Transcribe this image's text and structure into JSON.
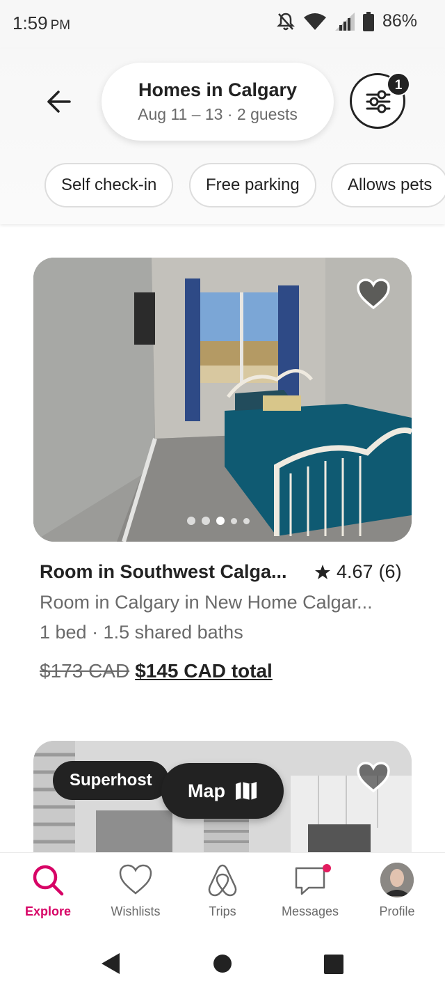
{
  "status_bar": {
    "time": "1:59",
    "ampm": "PM",
    "battery": "86%",
    "icons": [
      "notifications-off-icon",
      "wifi-icon",
      "signal-icon",
      "battery-icon"
    ]
  },
  "header": {
    "title": "Homes in Calgary",
    "subtitle": "Aug 11 – 13 · 2 guests",
    "filter_count": "1",
    "chips": [
      "Self check-in",
      "Free parking",
      "Allows pets"
    ]
  },
  "listings": [
    {
      "title": "Room in Southwest Calga...",
      "rating": "4.67",
      "reviews": "(6)",
      "subtitle": "Room in Calgary in New Home Calgar...",
      "beds": "1 bed · 1.5 shared baths",
      "old_price": "$173 CAD",
      "new_price": "$145 CAD total",
      "photo_count": 5,
      "active_photo": 3
    },
    {
      "badge": "Superhost"
    }
  ],
  "map_button": {
    "label": "Map"
  },
  "bottom_nav": {
    "items": [
      {
        "label": "Explore",
        "icon": "search-icon",
        "active": true
      },
      {
        "label": "Wishlists",
        "icon": "heart-icon"
      },
      {
        "label": "Trips",
        "icon": "airbnb-logo-icon"
      },
      {
        "label": "Messages",
        "icon": "message-icon"
      },
      {
        "label": "Profile",
        "icon": "avatar"
      }
    ]
  },
  "colors": {
    "accent": "#d70466",
    "text": "#222222",
    "muted": "#6a6a6a",
    "notification_dot": "#e31c5f"
  }
}
